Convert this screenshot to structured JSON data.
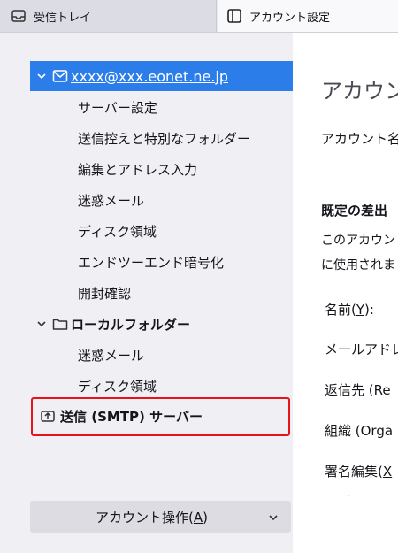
{
  "tabs": {
    "inbox": {
      "label": "受信トレイ",
      "icon": "inbox-icon"
    },
    "account_settings": {
      "label": "アカウント設定",
      "icon": "settings-panel-icon"
    }
  },
  "sidebar": {
    "account": {
      "name": "xxxx@xxx.eonet.ne.jp",
      "icon": "envelope-icon"
    },
    "account_items": [
      "サーバー設定",
      "送信控えと特別なフォルダー",
      "編集とアドレス入力",
      "迷惑メール",
      "ディスク領域",
      "エンドツーエンド暗号化",
      "開封確認"
    ],
    "local_folders": {
      "name": "ローカルフォルダー",
      "icon": "folder-icon"
    },
    "local_items": [
      "迷惑メール",
      "ディスク領域"
    ],
    "smtp": {
      "label": "送信 (SMTP) サーバー",
      "icon": "outbox-icon"
    },
    "account_actions": {
      "label_pre": "アカウント操作(",
      "label_key": "A",
      "label_post": ")"
    }
  },
  "main": {
    "heading": "アカウント",
    "account_name": "アカウント名(",
    "default_identity": "既定の差出",
    "desc_line1": "このアカウント",
    "desc_line2": "に使用されま",
    "name_pre": "名前(",
    "name_key": "Y",
    "name_post": "):",
    "email": "メールアドレス",
    "reply_to": "返信先 (Re",
    "organization": "組織 (Orga",
    "signature_pre": "署名編集(",
    "signature_key": "X"
  },
  "colors": {
    "selection": "#2b7de9",
    "highlight_border": "#e8121a"
  }
}
